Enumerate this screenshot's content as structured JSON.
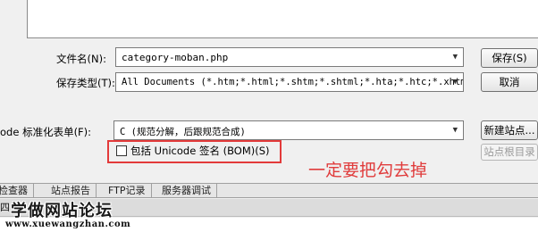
{
  "dialog": {
    "filename_label": "文件名(N):",
    "filename_value": "category-moban.php",
    "filetype_label": "保存类型(T):",
    "filetype_value": "All Documents (*.htm;*.html;*.shtm;*.shtml;*.hta;*.htc;*.xhtm",
    "normalize_label": "ode 标准化表单(F):",
    "normalize_value": "C (规范分解，后跟规范合成)",
    "bom_checkbox_label": "包括 Unicode 签名 (BOM)(S)",
    "bom_checked": false,
    "save_button": "保存(S)",
    "cancel_button": "取消",
    "new_site_button": "新建站点...",
    "site_root_button": "站点根目录"
  },
  "annotation": {
    "text": "一定要把勾去掉",
    "color": "#e03c3c"
  },
  "bottom_tabs": [
    "检查器",
    "站点报告",
    "FTP记录",
    "服务器调试"
  ],
  "bottom_panel_text": "四",
  "watermark": {
    "title": "学做网站论坛",
    "url": "www.xuewangzhan.com"
  }
}
